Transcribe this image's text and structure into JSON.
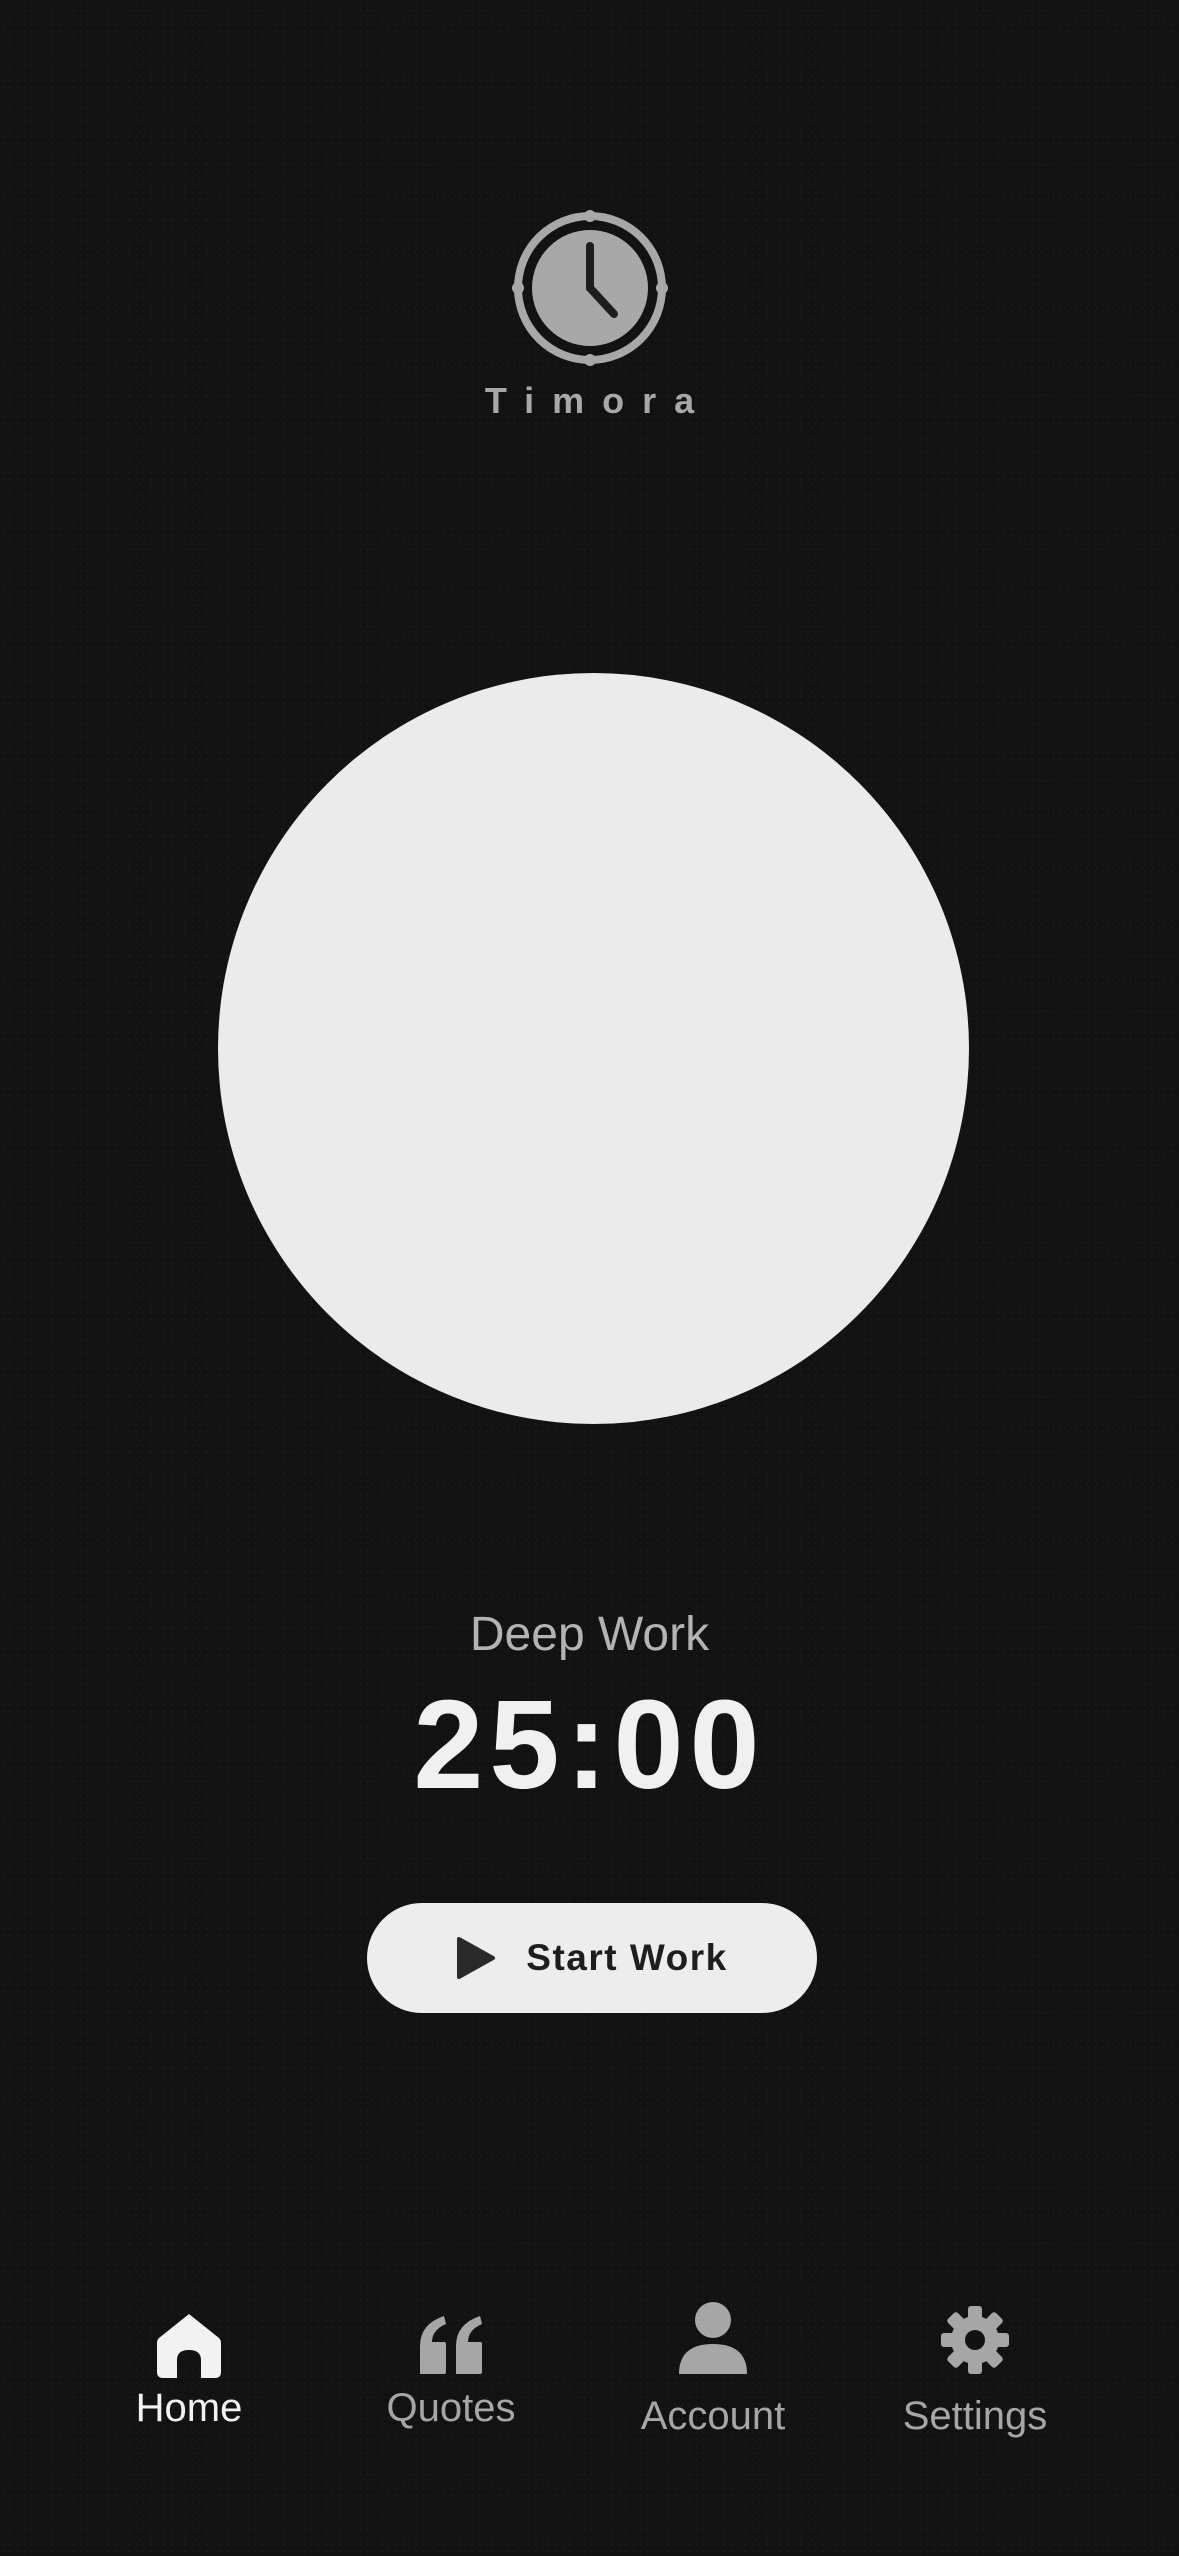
{
  "app": {
    "name": "Timora"
  },
  "timer": {
    "session_label": "Deep Work",
    "time": "25:00",
    "start_label": "Start Work"
  },
  "nav": {
    "items": [
      {
        "label": "Home",
        "icon": "home-icon",
        "active": true
      },
      {
        "label": "Quotes",
        "icon": "quote-icon",
        "active": false
      },
      {
        "label": "Account",
        "icon": "person-icon",
        "active": false
      },
      {
        "label": "Settings",
        "icon": "gear-icon",
        "active": false
      }
    ]
  },
  "colors": {
    "background": "#121212",
    "circle": "#ebebeb",
    "button": "#ededed",
    "text_primary": "#f0f0f0",
    "text_secondary": "#a6a6a6"
  }
}
